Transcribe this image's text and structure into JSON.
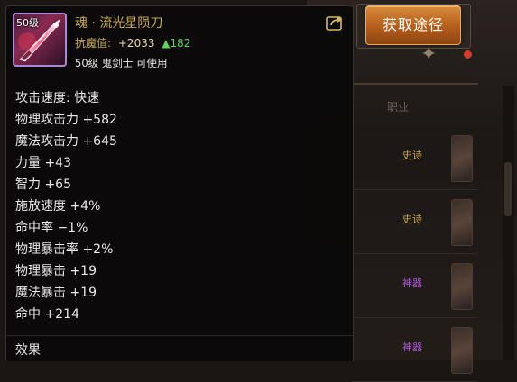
{
  "tooltip": {
    "item_level_badge": "50级",
    "item_name": "魂 · 流光星陨刀",
    "resist_label": "抗魔值:",
    "resist_value": "+2033",
    "resist_delta": "▲182",
    "class_requirement": "50级 鬼剑士 可使用",
    "stats": [
      "攻击速度: 快速",
      "物理攻击力 +582",
      "魔法攻击力 +645",
      "力量 +43",
      "智力 +65",
      "施放速度 +4%",
      "命中率 −1%",
      "物理暴击率 +2%",
      "物理暴击 +19",
      "魔法暴击 +19",
      "命中 +214"
    ],
    "effect_title": "效果",
    "icons": {
      "item": "sword-weapon-icon",
      "share": "share-arrow-icon"
    }
  },
  "background": {
    "source_button_label": "获取途径",
    "tab_label": "职业",
    "rows": [
      {
        "grade": "史诗",
        "grade_color": "#c9a84f"
      },
      {
        "grade": "史诗",
        "grade_color": "#c9a84f"
      },
      {
        "grade": "神器",
        "grade_color": "#b05ad8"
      },
      {
        "grade": "神器",
        "grade_color": "#b05ad8"
      }
    ]
  },
  "colors": {
    "item_name": "#c9a84f",
    "stat_text": "#e8e8e8",
    "resist_delta": "#5fd35a",
    "icon_border": "#b087d8",
    "button_orange": "#c46a22"
  }
}
